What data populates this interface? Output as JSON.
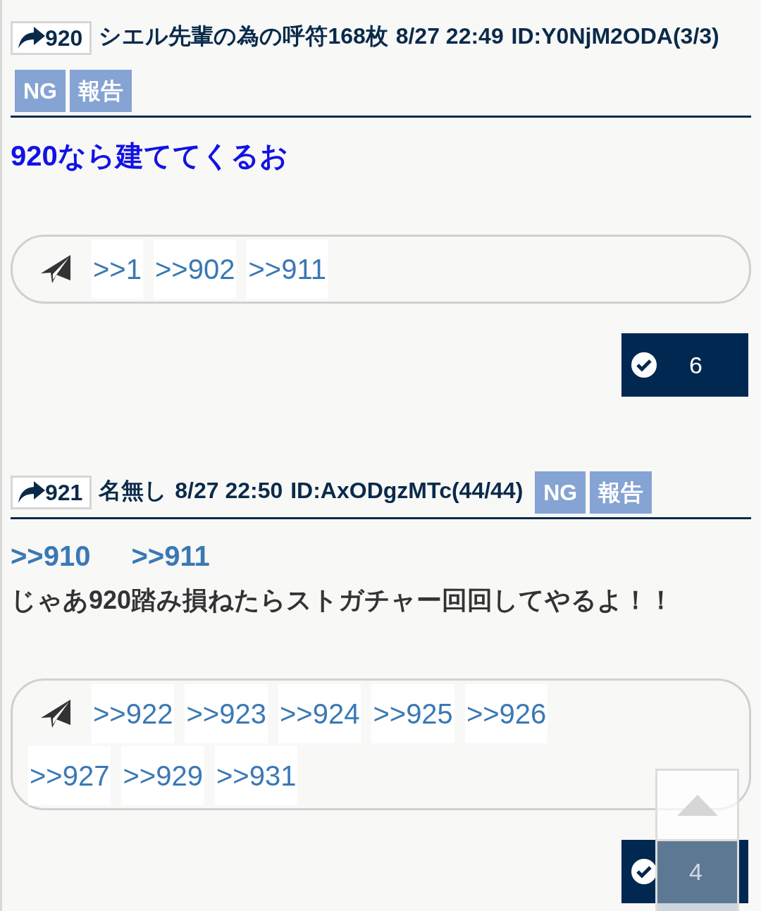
{
  "posts": [
    {
      "number": "920",
      "name": "シエル先輩の為の呼符168枚",
      "date": "8/27 22:49",
      "id": "ID:Y0NjM2ODA(3/3)",
      "buttons": [
        "NG",
        "報告"
      ],
      "body": [
        {
          "kind": "emphasis",
          "text": "920なら建ててくるお"
        }
      ],
      "replies": [
        ">>1",
        ">>902",
        ">>911"
      ],
      "likes": "6"
    },
    {
      "number": "921",
      "name": "名無し",
      "date": "8/27 22:50",
      "id": "ID:AxODgzMTc(44/44)",
      "buttons": [
        "NG",
        "報告"
      ],
      "body": [
        {
          "kind": "anchors",
          "items": [
            ">>910",
            ">>911"
          ]
        },
        {
          "kind": "text",
          "text": "じゃあ920踏み損ねたらストガチャー回回してやるよ！！"
        }
      ],
      "replies": [
        ">>922",
        ">>923",
        ">>924",
        ">>925",
        ">>926",
        ">>927",
        ">>929",
        ">>931"
      ],
      "likes": "4"
    }
  ]
}
